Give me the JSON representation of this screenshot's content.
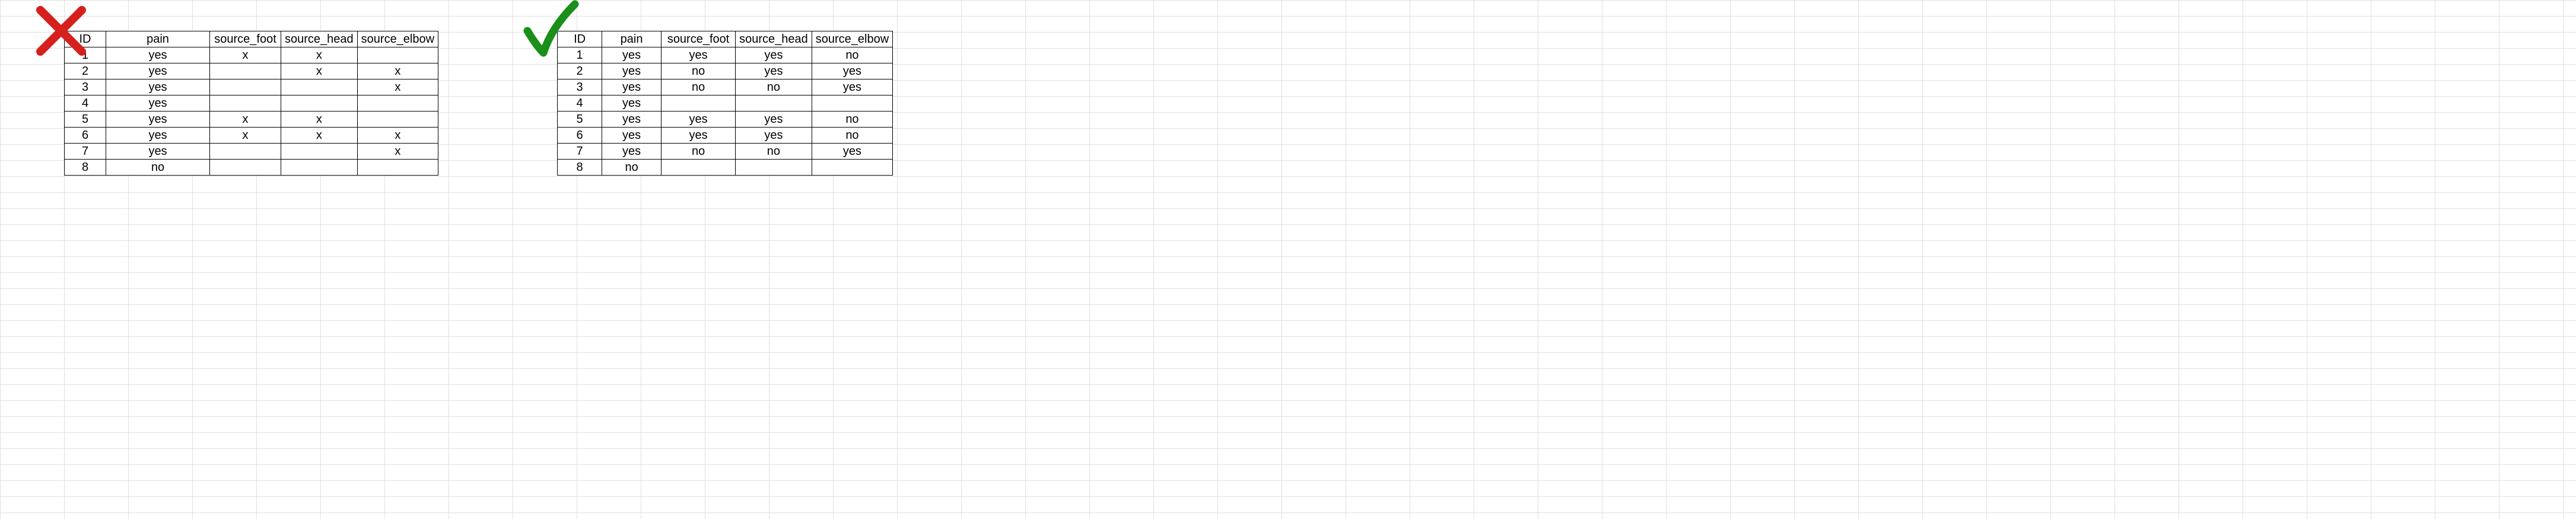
{
  "left": {
    "headers": [
      "ID",
      "pain",
      "source_foot",
      "source_head",
      "source_elbow"
    ],
    "rows": [
      [
        "1",
        "yes",
        "x",
        "x",
        ""
      ],
      [
        "2",
        "yes",
        "",
        "x",
        "x"
      ],
      [
        "3",
        "yes",
        "",
        "",
        "x"
      ],
      [
        "4",
        "yes",
        "",
        "",
        ""
      ],
      [
        "5",
        "yes",
        "x",
        "x",
        ""
      ],
      [
        "6",
        "yes",
        "x",
        "x",
        "x"
      ],
      [
        "7",
        "yes",
        "",
        "",
        "x"
      ],
      [
        "8",
        "no",
        "",
        "",
        ""
      ]
    ]
  },
  "right": {
    "headers": [
      "ID",
      "pain",
      "source_foot",
      "source_head",
      "source_elbow"
    ],
    "rows": [
      [
        "1",
        "yes",
        "yes",
        "yes",
        "no"
      ],
      [
        "2",
        "yes",
        "no",
        "yes",
        "yes"
      ],
      [
        "3",
        "yes",
        "no",
        "no",
        "yes"
      ],
      [
        "4",
        "yes",
        "",
        "",
        ""
      ],
      [
        "5",
        "yes",
        "yes",
        "yes",
        "no"
      ],
      [
        "6",
        "yes",
        "yes",
        "yes",
        "no"
      ],
      [
        "7",
        "yes",
        "no",
        "no",
        "yes"
      ],
      [
        "8",
        "no",
        "",
        "",
        ""
      ]
    ]
  }
}
